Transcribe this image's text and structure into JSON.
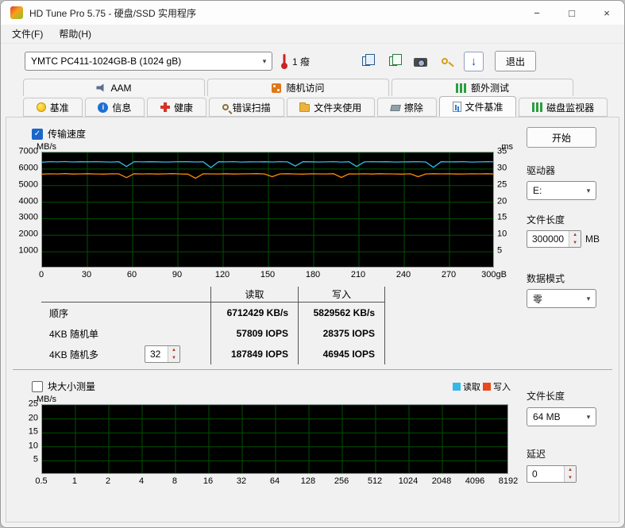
{
  "window": {
    "title": "HD Tune Pro 5.75 - 硬盘/SSD 实用程序",
    "minimize": "−",
    "maximize": "□",
    "close": "×"
  },
  "menubar": {
    "file": "文件(F)",
    "help": "帮助(H)"
  },
  "icons": {
    "chevron_down": "▾",
    "spin_up": "▲",
    "spin_down": "▼",
    "update_arrow": "↓",
    "check": "✓",
    "info_letter": "i"
  },
  "toolbar": {
    "drive_dropdown": "YMTC PC411-1024GB-B (1024 gB)",
    "temperature": "1 癈",
    "exit_button": "退出"
  },
  "tabs": {
    "row1": [
      {
        "label": "AAM"
      },
      {
        "label": "随机访问"
      },
      {
        "label": "额外测试"
      }
    ],
    "row2": [
      {
        "label": "基准"
      },
      {
        "label": "信息"
      },
      {
        "label": "健康"
      },
      {
        "label": "错误扫描"
      },
      {
        "label": "文件夹使用"
      },
      {
        "label": "擦除"
      },
      {
        "label": "文件基准"
      },
      {
        "label": "磁盘监视器"
      }
    ],
    "active_tab": "文件基准"
  },
  "file_benchmark": {
    "transfer_speed_label": "传输速度",
    "block_size_label": "块大小测量",
    "legend_read": "读取",
    "legend_write": "写入",
    "legend_read_color": "#35b8e8",
    "legend_write_color": "#e8491d",
    "results": {
      "read_header": "读取",
      "write_header": "写入",
      "queue_depth": "32",
      "rows": [
        {
          "label": "顺序",
          "read": "6712429 KB/s",
          "write": "5829562 KB/s"
        },
        {
          "label": "4KB 随机单",
          "read": "57809 IOPS",
          "write": "28375 IOPS"
        },
        {
          "label": "4KB 随机多",
          "read": "187849 IOPS",
          "write": "46945 IOPS"
        }
      ]
    }
  },
  "sidebar": {
    "start_button": "开始",
    "drive_label": "驱动器",
    "drive_value": "E:",
    "file_length_label": "文件长度",
    "file_length_value": "300000",
    "file_length_unit": "MB",
    "data_pattern_label": "数据模式",
    "data_pattern_value": "零",
    "block_file_length_label": "文件长度",
    "block_file_length_value": "64 MB",
    "delay_label": "延迟",
    "delay_value": "0"
  },
  "chart_data": [
    {
      "type": "line",
      "title": "传输速度",
      "ylabel": "MB/s",
      "y2label": "ms",
      "ylim": [
        0,
        7000
      ],
      "yticks": [
        1000,
        2000,
        3000,
        4000,
        5000,
        6000,
        7000
      ],
      "y2lim": [
        0,
        35
      ],
      "y2ticks": [
        5,
        10,
        15,
        20,
        25,
        30,
        35
      ],
      "xticks": [
        "0",
        "30",
        "60",
        "90",
        "120",
        "150",
        "180",
        "210",
        "240",
        "270",
        "300gB"
      ],
      "grid": true,
      "grid_color": "#005200",
      "background": "#000000",
      "series": [
        {
          "name": "读取",
          "color": "#35b8e8",
          "unit": "MB/s",
          "values": [
            6410,
            6445,
            6430,
            6450,
            6425,
            6440,
            6435,
            6445,
            6430,
            6420,
            6440,
            6150,
            6445,
            6430,
            6440,
            6435,
            6420,
            6430,
            6445,
            6440,
            6425,
            6435,
            6090,
            6440,
            6430,
            6445,
            6420,
            6435,
            6430,
            6440,
            6425,
            6445,
            6430,
            6180,
            6440,
            6435,
            6425,
            6430,
            6445,
            6420,
            6440,
            6150,
            6430,
            6445,
            6435,
            6440,
            6420,
            6430,
            6435,
            6445,
            6425,
            6100,
            6440,
            6430,
            6435,
            6445,
            6420,
            6430,
            6440,
            6435
          ]
        },
        {
          "name": "写入",
          "color": "#ff8a00",
          "unit": "MB/s",
          "values": [
            5690,
            5710,
            5700,
            5720,
            5695,
            5705,
            5715,
            5700,
            5690,
            5710,
            5705,
            5480,
            5715,
            5700,
            5710,
            5695,
            5705,
            5720,
            5700,
            5690,
            5440,
            5710,
            5705,
            5700,
            5715,
            5695,
            5705,
            5710,
            5720,
            5700,
            5540,
            5705,
            5715,
            5700,
            5690,
            5710,
            5705,
            5700,
            5715,
            5490,
            5705,
            5700,
            5710,
            5695,
            5715,
            5705,
            5700,
            5690,
            5710,
            5540,
            5700,
            5715,
            5705,
            5710,
            5695,
            5700,
            5710,
            5705,
            5715,
            5700
          ]
        }
      ]
    },
    {
      "type": "line",
      "title": "块大小测量",
      "ylabel": "MB/s",
      "ylim": [
        0,
        25
      ],
      "yticks": [
        5,
        10,
        15,
        20,
        25
      ],
      "xticks": [
        "0.5",
        "1",
        "2",
        "4",
        "8",
        "16",
        "32",
        "64",
        "128",
        "256",
        "512",
        "1024",
        "2048",
        "4096",
        "8192"
      ],
      "grid": true,
      "grid_color": "#005200",
      "background": "#000000",
      "series": []
    }
  ]
}
